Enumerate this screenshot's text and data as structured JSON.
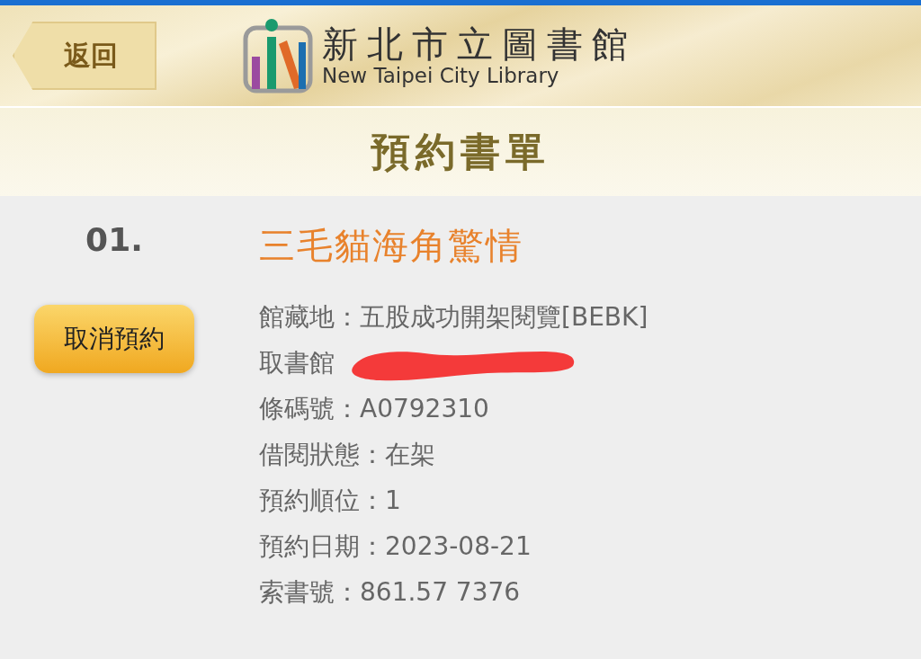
{
  "header": {
    "back_button": "返回",
    "logo_title": "新北市立圖書館",
    "logo_subtitle": "New Taipei City Library"
  },
  "page_title": "預約書單",
  "reservations": [
    {
      "number": "01.",
      "action": "取消預約",
      "title": "三毛貓海角驚情",
      "details": [
        {
          "kind": "text",
          "text": "館藏地：五股成功開架閱覽[BEBK]"
        },
        {
          "kind": "redacted",
          "text": "取書館"
        },
        {
          "kind": "text",
          "text": "條碼號：A0792310"
        },
        {
          "kind": "text",
          "text": "借閱狀態：在架"
        },
        {
          "kind": "text",
          "text": "預約順位：1"
        },
        {
          "kind": "text",
          "text": "預約日期：2023-08-21"
        },
        {
          "kind": "text",
          "text": "索書號：861.57 7376"
        }
      ]
    }
  ]
}
